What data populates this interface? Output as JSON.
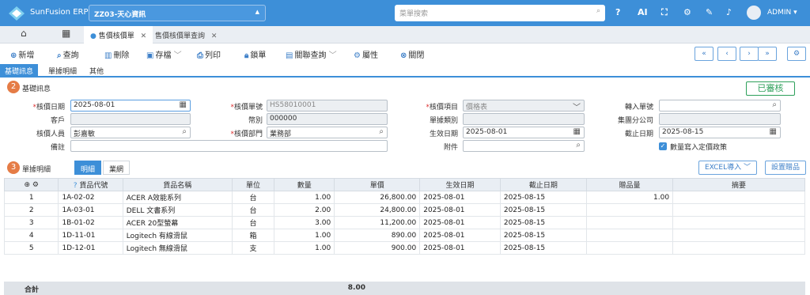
{
  "header": {
    "brand": "SunFusion ERP",
    "company": "ZZ03-天心資訊",
    "search_placeholder": "菜單搜索",
    "user": "ADMIN",
    "icons": [
      "help-icon",
      "ai-icon",
      "fullscreen-icon",
      "gear-icon",
      "theme-icon",
      "bell-icon"
    ]
  },
  "tabs": [
    {
      "label": "售價核價單",
      "active": true
    },
    {
      "label": "售價核價單查詢",
      "active": false
    }
  ],
  "toolbar": {
    "add": "新增",
    "query": "查詢",
    "delete": "刪除",
    "save": "存檔",
    "print": "列印",
    "lock": "鎖單",
    "related": "關聯查詢",
    "props": "屬性",
    "close": "關閉"
  },
  "subtabs": [
    "基礎訊息",
    "單據明細",
    "其他"
  ],
  "section1": {
    "num": "2",
    "title": "基礎訊息",
    "status": "已審核"
  },
  "form": {
    "price_date_label": "核價日期",
    "price_date": "2025-08-01",
    "doc_no_label": "核價單號",
    "doc_no": "HS58010001",
    "item_label": "核價項目",
    "item": "價格表",
    "transfer_label": "轉入單號",
    "transfer": "",
    "customer_label": "客戶",
    "customer": "",
    "currency_label": "幣別",
    "currency": "000000",
    "doc_type_label": "單據類別",
    "doc_type": "",
    "group_label": "集團分公司",
    "group": "",
    "person_label": "核價人員",
    "person": "彭嘉敏",
    "dept_label": "核價部門",
    "dept": "業務部",
    "eff_date_label": "生效日期",
    "eff_date": "2025-08-01",
    "end_date_label": "截止日期",
    "end_date": "2025-08-15",
    "remark_label": "備註",
    "remark": "",
    "attach_label": "附件",
    "attach": "",
    "checkbox_label": "數量寫入定價政策"
  },
  "section2": {
    "num": "3",
    "title": "單據明細",
    "tab_detail": "明細",
    "tab_rules": "業網",
    "excel": "EXCEL導入",
    "gift": "設置贈品"
  },
  "table": {
    "columns": [
      "",
      "貨品代號",
      "貨品名稱",
      "單位",
      "數量",
      "單價",
      "生效日期",
      "截止日期",
      "贈品量",
      "摘要"
    ],
    "rows": [
      [
        "1",
        "1A-02-02",
        "ACER A效能系列",
        "台",
        "1.00",
        "26,800.00",
        "2025-08-01",
        "2025-08-15",
        "1.00",
        ""
      ],
      [
        "2",
        "1A-03-01",
        "DELL 文書系列",
        "台",
        "2.00",
        "24,800.00",
        "2025-08-01",
        "2025-08-15",
        "",
        ""
      ],
      [
        "3",
        "1B-01-02",
        "ACER 20型螢幕",
        "台",
        "3.00",
        "11,200.00",
        "2025-08-01",
        "2025-08-15",
        "",
        ""
      ],
      [
        "4",
        "1D-11-01",
        "Logitech 有線滑鼠",
        "箱",
        "1.00",
        "890.00",
        "2025-08-01",
        "2025-08-15",
        "",
        ""
      ],
      [
        "5",
        "1D-12-01",
        "Logitech 無線滑鼠",
        "支",
        "1.00",
        "900.00",
        "2025-08-01",
        "2025-08-15",
        "",
        ""
      ]
    ],
    "total_label": "合計",
    "total_qty": "8.00"
  },
  "colors": {
    "primary": "#3d8fd8",
    "approved": "#2da05a",
    "badge": "#e57c46"
  }
}
